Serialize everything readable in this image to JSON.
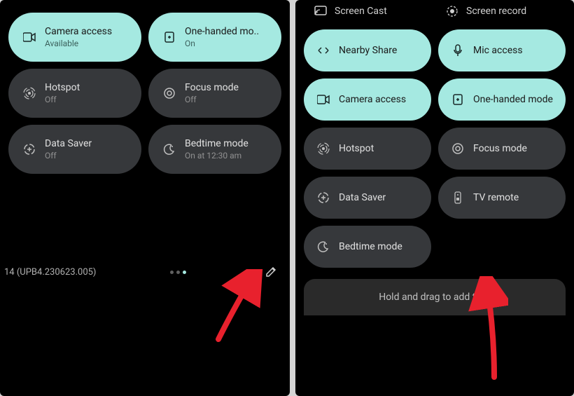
{
  "left": {
    "tiles": [
      {
        "label": "Camera access",
        "status": "Available",
        "active": true,
        "icon": "camera"
      },
      {
        "label": "One-handed mo..",
        "status": "On",
        "active": true,
        "icon": "onehanded"
      },
      {
        "label": "Hotspot",
        "status": "Off",
        "active": false,
        "icon": "hotspot"
      },
      {
        "label": "Focus mode",
        "status": "Off",
        "active": false,
        "icon": "focus"
      },
      {
        "label": "Data Saver",
        "status": "Off",
        "active": false,
        "icon": "datasaver"
      },
      {
        "label": "Bedtime mode",
        "status": "On at 12:30 am",
        "active": false,
        "icon": "bedtime"
      }
    ],
    "version": "14 (UPB4.230623.005)"
  },
  "right": {
    "header": [
      {
        "label": "Screen Cast",
        "icon": "cast"
      },
      {
        "label": "Screen record",
        "icon": "record"
      }
    ],
    "tiles": [
      {
        "label": "Nearby Share",
        "active": true,
        "icon": "nearby"
      },
      {
        "label": "Mic access",
        "active": true,
        "icon": "mic"
      },
      {
        "label": "Camera access",
        "active": true,
        "icon": "camera"
      },
      {
        "label": "One-handed mode",
        "active": true,
        "icon": "onehanded"
      },
      {
        "label": "Hotspot",
        "active": false,
        "icon": "hotspot"
      },
      {
        "label": "Focus mode",
        "active": false,
        "icon": "focus"
      },
      {
        "label": "Data Saver",
        "active": false,
        "icon": "datasaver"
      },
      {
        "label": "TV remote",
        "active": false,
        "icon": "tvremote"
      },
      {
        "label": "Bedtime mode",
        "active": false,
        "icon": "bedtime"
      }
    ],
    "hint": "Hold and drag to add tiles"
  }
}
